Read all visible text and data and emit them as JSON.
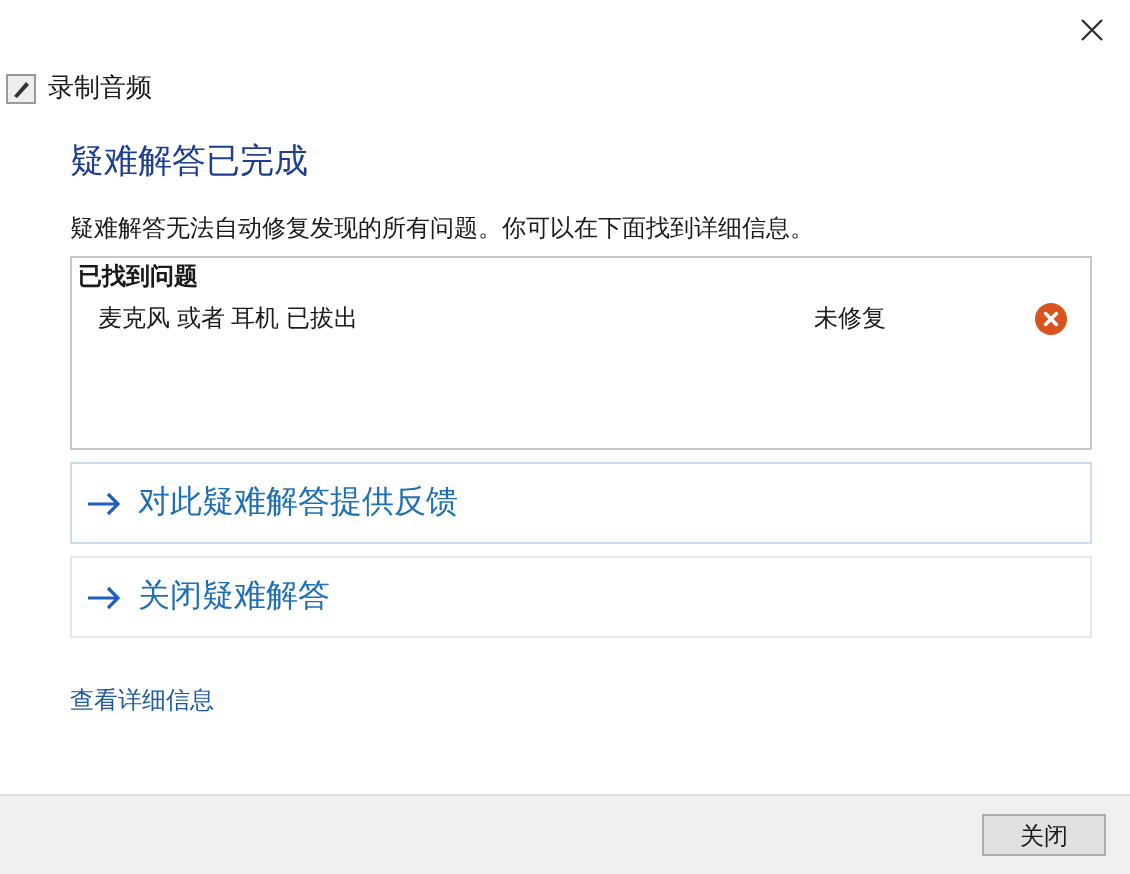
{
  "window": {
    "title": "录制音频"
  },
  "heading": "疑难解答已完成",
  "description": "疑难解答无法自动修复发现的所有问题。你可以在下面找到详细信息。",
  "problems": {
    "title": "已找到问题",
    "items": [
      {
        "name": "麦克风 或者 耳机 已拔出",
        "status": "未修复",
        "kind": "error"
      }
    ]
  },
  "actions": [
    "对此疑难解答提供反馈",
    "关闭疑难解答"
  ],
  "details_link": "查看详细信息",
  "footer": {
    "button": "关闭"
  }
}
